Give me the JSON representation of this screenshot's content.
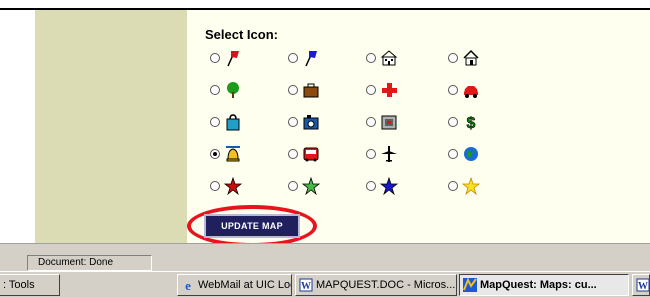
{
  "select_icon_label": "Select Icon:",
  "icon_options": [
    {
      "icon": "red-flag-icon",
      "checked": false
    },
    {
      "icon": "blue-flag-icon",
      "checked": false
    },
    {
      "icon": "building-icon",
      "checked": false
    },
    {
      "icon": "house-icon",
      "checked": false
    },
    {
      "icon": "tree-icon",
      "checked": false
    },
    {
      "icon": "briefcase-icon",
      "checked": false
    },
    {
      "icon": "red-cross-icon",
      "checked": false
    },
    {
      "icon": "car-icon",
      "checked": false
    },
    {
      "icon": "shopping-bag-icon",
      "checked": false
    },
    {
      "icon": "camera-icon",
      "checked": false
    },
    {
      "icon": "stadium-icon",
      "checked": false
    },
    {
      "icon": "dollar-icon",
      "checked": false
    },
    {
      "icon": "bell-icon",
      "checked": true
    },
    {
      "icon": "bus-icon",
      "checked": false
    },
    {
      "icon": "airplane-icon",
      "checked": false
    },
    {
      "icon": "globe-icon",
      "checked": false
    },
    {
      "icon": "red-star-icon",
      "checked": false
    },
    {
      "icon": "green-star-icon",
      "checked": false
    },
    {
      "icon": "blue-star-icon",
      "checked": false
    },
    {
      "icon": "yellow-star-icon",
      "checked": false
    }
  ],
  "update_button_label": "UPDATE MAP",
  "status_text": "Document: Done",
  "taskbar": {
    "items": [
      {
        "label": ": Tools",
        "active": false
      },
      {
        "label": "WebMail at UIC Login Scr...",
        "active": false
      },
      {
        "label": "MAPQUEST.DOC - Micros...",
        "active": false
      },
      {
        "label": "MapQuest: Maps: cu...",
        "active": true
      },
      {
        "label": "",
        "active": false
      }
    ]
  },
  "colors": {
    "sidebar": "#dcdcb4",
    "content_bg": "#fffff0",
    "button_bg": "#20205f",
    "highlight_oval": "#e8131d",
    "chrome": "#d4d0c8"
  }
}
